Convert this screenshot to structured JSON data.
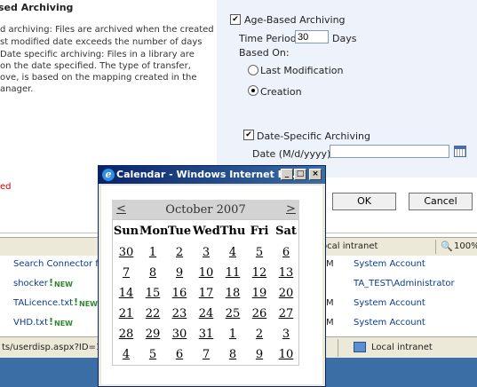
{
  "left": {
    "title": "sed Archiving",
    "lines": [
      "d archiving: Files are archived when the created",
      "st modified date exceeds the number of days",
      "Date specific archiving: Files in a library are",
      "on the date specified. The type of transfer,",
      "ove, is based on the mapping created in the",
      "anager."
    ],
    "error_text": "ed"
  },
  "archiving": {
    "age_based_label": "Age-Based Archiving",
    "age_based_checked": "✔",
    "time_period_label": "Time Period:",
    "time_period_value": "30",
    "days_label": "Days",
    "based_on_label": "Based On:",
    "last_modification_label": "Last Modification",
    "creation_label": "Creation",
    "date_specific_label": "Date-Specific Archiving",
    "date_specific_checked": "✔",
    "date_label": "Date (M/d/yyyy):",
    "date_value": ""
  },
  "buttons": {
    "ok": "OK",
    "cancel": "Cancel"
  },
  "status": {
    "zone": "Local intranet",
    "zoom": "100%",
    "zone_label_partial": "ocal intranet"
  },
  "list": {
    "rows": [
      {
        "name": "Search Connector fo",
        "is_new": false,
        "col": "M",
        "account": "System Account"
      },
      {
        "name": "shocker",
        "is_new": true,
        "col": "",
        "account": "TA_TEST\\Administrator"
      },
      {
        "name": "TALicence.txt",
        "is_new": true,
        "col": "M",
        "account": "System Account"
      },
      {
        "name": "VHD.txt",
        "is_new": true,
        "col": "M",
        "account": "System Account"
      }
    ],
    "new_label": "NEW",
    "new_bang": "!"
  },
  "bottom": {
    "url": "ts/userdisp.aspx?ID=1",
    "zone": "Local intranet"
  },
  "popup": {
    "title": "Calendar - Windows Internet E...",
    "calendar": {
      "prev": "<",
      "next": ">",
      "month_title": "October 2007",
      "weekdays": [
        "Sun",
        "Mon",
        "Tue",
        "Wed",
        "Thu",
        "Fri",
        "Sat"
      ],
      "weeks": [
        [
          "30",
          "1",
          "2",
          "3",
          "4",
          "5",
          "6"
        ],
        [
          "7",
          "8",
          "9",
          "10",
          "11",
          "12",
          "13"
        ],
        [
          "14",
          "15",
          "16",
          "17",
          "18",
          "19",
          "20"
        ],
        [
          "21",
          "22",
          "23",
          "24",
          "25",
          "26",
          "27"
        ],
        [
          "28",
          "29",
          "30",
          "31",
          "1",
          "2",
          "3"
        ],
        [
          "4",
          "5",
          "6",
          "7",
          "8",
          "9",
          "10"
        ]
      ]
    }
  },
  "colors": {
    "panel": "#eef2fb",
    "titlebar": "#0a246a",
    "link": "#0a3c8e",
    "new": "#2a8a2a",
    "error": "#cc0000"
  }
}
